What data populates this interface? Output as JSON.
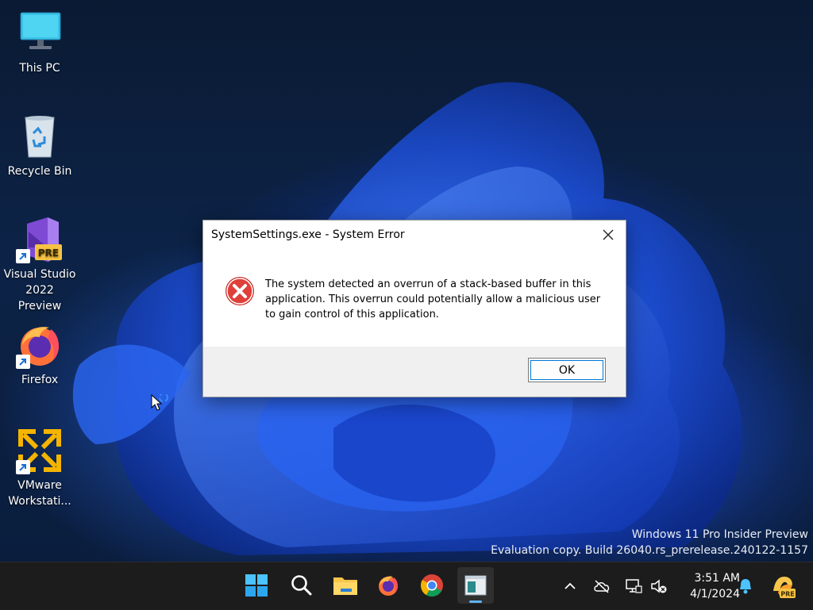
{
  "desktop": {
    "icons": [
      {
        "label": "This PC"
      },
      {
        "label": "Recycle Bin"
      },
      {
        "label": "Visual Studio 2022 Preview",
        "badge": "PRE"
      },
      {
        "label": "Firefox"
      },
      {
        "label": "VMware Workstati..."
      }
    ],
    "watermark": {
      "line1": "Windows 11 Pro Insider Preview",
      "line2": "Evaluation copy. Build 26040.rs_prerelease.240122-1157"
    }
  },
  "dialog": {
    "title": "SystemSettings.exe - System Error",
    "message": "The system detected an overrun of a stack-based buffer in this application. This overrun could potentially allow a malicious user to gain control of this application.",
    "ok_label": "OK",
    "icon": "error-icon"
  },
  "taskbar": {
    "apps": [
      {
        "name": "start-button",
        "icon": "windows-logo-icon"
      },
      {
        "name": "search-button",
        "icon": "search-icon"
      },
      {
        "name": "file-explorer",
        "icon": "folder-icon"
      },
      {
        "name": "firefox",
        "icon": "firefox-icon"
      },
      {
        "name": "chrome",
        "icon": "chrome-icon"
      },
      {
        "name": "system-settings",
        "icon": "settings-window-icon",
        "active": true
      }
    ],
    "tray": {
      "icons": [
        "chevron-up-icon",
        "cloud-offline-icon",
        "network-icon",
        "volume-muted-icon"
      ],
      "time": "3:51 AM",
      "date": "4/1/2024",
      "copilot_badge": "PRE"
    }
  },
  "colors": {
    "accent": "#0078d7",
    "error_red": "#d9322e",
    "taskbar_bg": "#1c1c1c"
  }
}
